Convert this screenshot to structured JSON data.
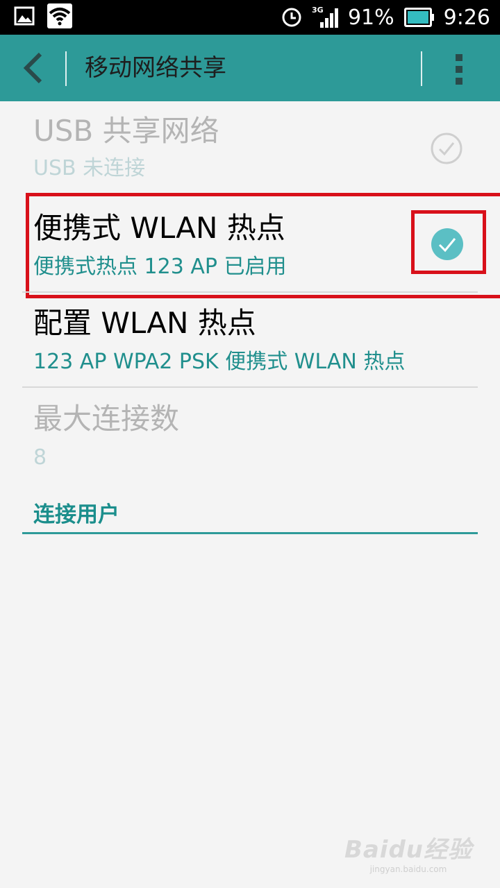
{
  "status_bar": {
    "network_type": "3G",
    "battery_percent": "91%",
    "time": "9:26",
    "left_icons": [
      "gallery-icon",
      "wifi-icon"
    ],
    "right_icons": [
      "alarm-clock-icon",
      "signal-icon",
      "battery-icon"
    ]
  },
  "app_bar": {
    "title": "移动网络共享",
    "back_icon": "back-chevron-icon",
    "menu_icon": "overflow-menu-icon"
  },
  "items": [
    {
      "title": "USB 共享网络",
      "subtitle": "USB 未连接",
      "enabled": false,
      "checked": false
    },
    {
      "title": "便携式 WLAN 热点",
      "subtitle": "便携式热点 123 AP 已启用",
      "enabled": true,
      "checked": true
    },
    {
      "title": "配置 WLAN 热点",
      "subtitle": "123 AP WPA2 PSK 便携式 WLAN 热点",
      "enabled": true
    },
    {
      "title": "最大连接数",
      "subtitle": "8",
      "enabled": false
    }
  ],
  "section": {
    "header": "连接用户"
  },
  "watermark": {
    "logo": "Baidu经验",
    "url": "jingyan.baidu.com"
  },
  "colors": {
    "accent": "#2d9a98",
    "accent_text": "#208f8d",
    "highlight_frame": "#d8101a",
    "background": "#f4f4f4"
  }
}
